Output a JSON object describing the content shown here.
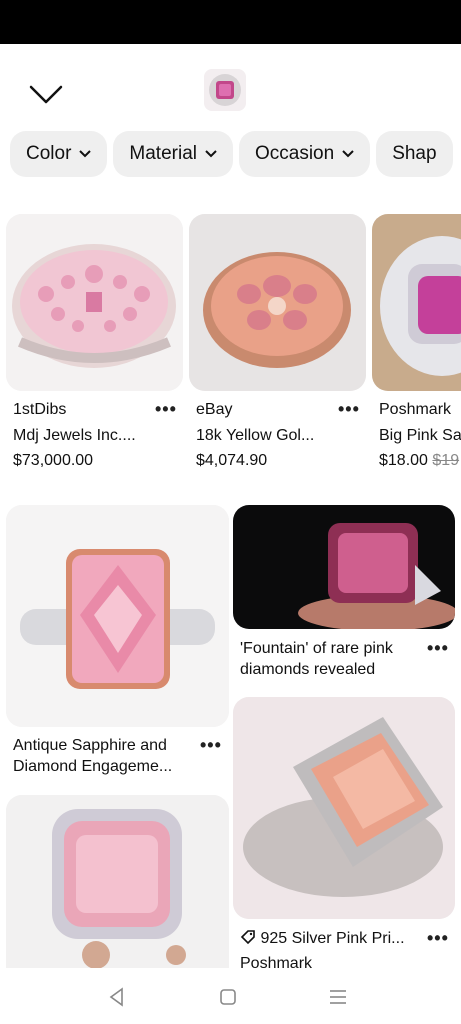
{
  "header": {
    "back_icon": "chevron-down-icon",
    "thumbnail_icon": "pink-ring-thumbnail"
  },
  "filters": [
    {
      "label": "Color"
    },
    {
      "label": "Material"
    },
    {
      "label": "Occasion"
    },
    {
      "label": "Shap"
    }
  ],
  "products": [
    {
      "source": "1stDibs",
      "title": "Mdj Jewels Inc....",
      "price": "$73,000.00",
      "old_price": ""
    },
    {
      "source": "eBay",
      "title": "18k Yellow Gol...",
      "price": "$4,074.90",
      "old_price": ""
    },
    {
      "source": "Poshmark",
      "title": "Big Pink Sa",
      "price": "$18.00",
      "old_price": "$19"
    }
  ],
  "pins": [
    {
      "title": "Antique Sapphire and Diamond Engageme..."
    },
    {
      "title": "'Fountain' of rare pink diamonds revealed"
    },
    {
      "title": "925 Silver Pink Pri...",
      "source": "Poshmark",
      "tag_icon": "price-tag-icon"
    }
  ],
  "more_label": "•••",
  "colors": {
    "chip_bg": "#efefef",
    "pink": "#e9a0b8",
    "rose_gold": "#d79a7a"
  },
  "navigation": {
    "back": "triangle-back-icon",
    "home": "square-home-icon",
    "menu": "lines-menu-icon"
  }
}
